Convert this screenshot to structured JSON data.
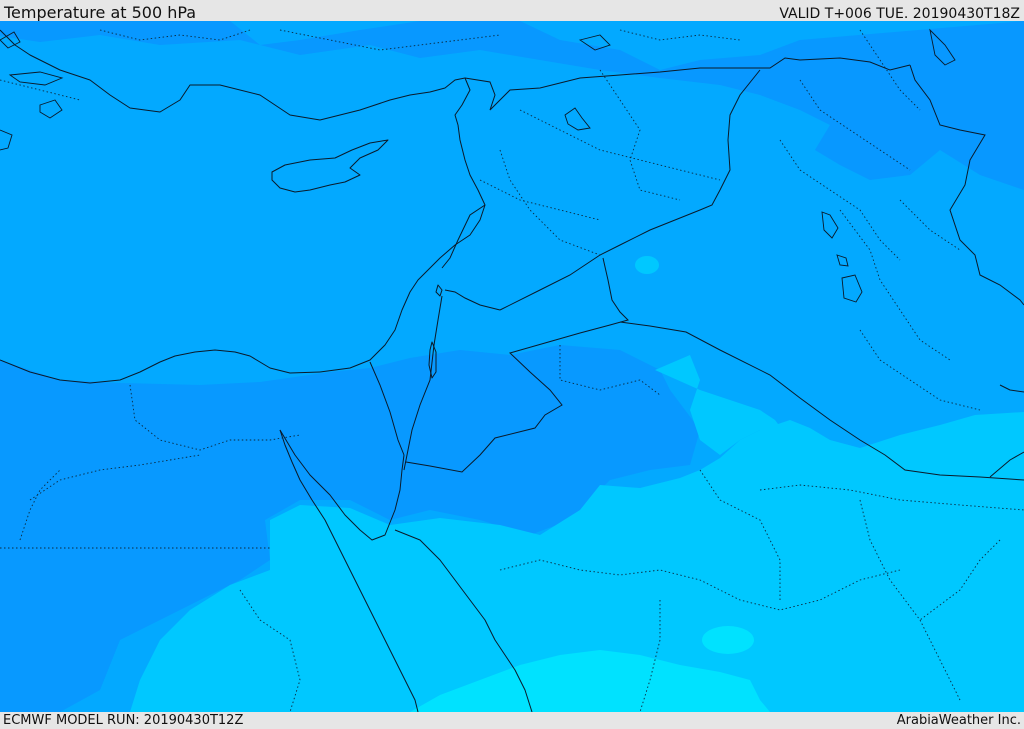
{
  "header": {
    "title": "Temperature at 500 hPa",
    "valid": "VALID T+006 TUE. 20190430T18Z"
  },
  "footer": {
    "model_run": "ECMWF MODEL RUN: 20190430T12Z",
    "credit": "ArabiaWeather Inc."
  },
  "map": {
    "field": "temperature",
    "level": "500 hPa",
    "fill_colors": {
      "dark": "#0898ff",
      "mid": "#03a9ff",
      "mid_south": "#00b4ff",
      "light": "#00c8ff",
      "lightest": "#00e2ff"
    },
    "line_colors": {
      "coast_border": "#0a1a2a",
      "internal_border": "#0a2a40"
    }
  }
}
